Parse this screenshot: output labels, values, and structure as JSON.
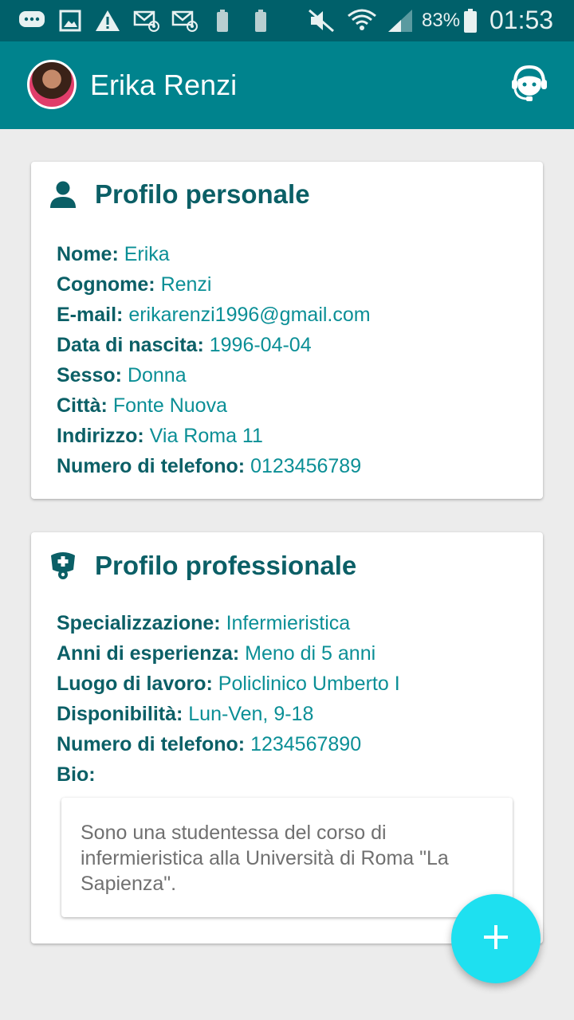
{
  "status_bar": {
    "battery_percent": "83%",
    "time": "01:53"
  },
  "app_bar": {
    "title": "Erika Renzi"
  },
  "personal_profile": {
    "title": "Profilo personale",
    "fields": [
      {
        "label": "Nome:",
        "value": "Erika"
      },
      {
        "label": "Cognome:",
        "value": "Renzi"
      },
      {
        "label": "E-mail:",
        "value": "erikarenzi1996@gmail.com"
      },
      {
        "label": "Data di nascita:",
        "value": "1996-04-04"
      },
      {
        "label": "Sesso:",
        "value": "Donna"
      },
      {
        "label": "Città:",
        "value": "Fonte Nuova"
      },
      {
        "label": "Indirizzo:",
        "value": "Via Roma 11"
      },
      {
        "label": "Numero di telefono:",
        "value": "0123456789"
      }
    ]
  },
  "professional_profile": {
    "title": "Profilo professionale",
    "fields": [
      {
        "label": "Specializzazione:",
        "value": "Infermieristica"
      },
      {
        "label": "Anni di esperienza:",
        "value": "Meno di 5 anni"
      },
      {
        "label": "Luogo di lavoro:",
        "value": "Policlinico Umberto I"
      },
      {
        "label": "Disponibilità:",
        "value": "Lun-Ven, 9-18"
      },
      {
        "label": "Numero di telefono:",
        "value": "1234567890"
      },
      {
        "label": "Bio:",
        "value": ""
      }
    ],
    "bio_text": "Sono una studentessa del corso di infermieristica alla Università di Roma \"La Sapienza\"."
  },
  "colors": {
    "primary": "#00838d",
    "status_bar": "#00606a",
    "label_text": "#0b5f66",
    "value_text": "#0b8f96",
    "fab": "#1ee0f0"
  },
  "icons": {
    "status_bar": [
      "message-icon",
      "image-icon",
      "warning-icon",
      "mail-at-icon",
      "mail-at-icon",
      "battery-icon",
      "battery-icon",
      "mute-icon",
      "wifi-icon",
      "signal-icon",
      "battery-icon"
    ],
    "app_bar": [
      "avatar",
      "support-agent-icon"
    ],
    "personal_card": "person-icon",
    "professional_card": "nurse-icon",
    "fab": "plus-icon"
  }
}
